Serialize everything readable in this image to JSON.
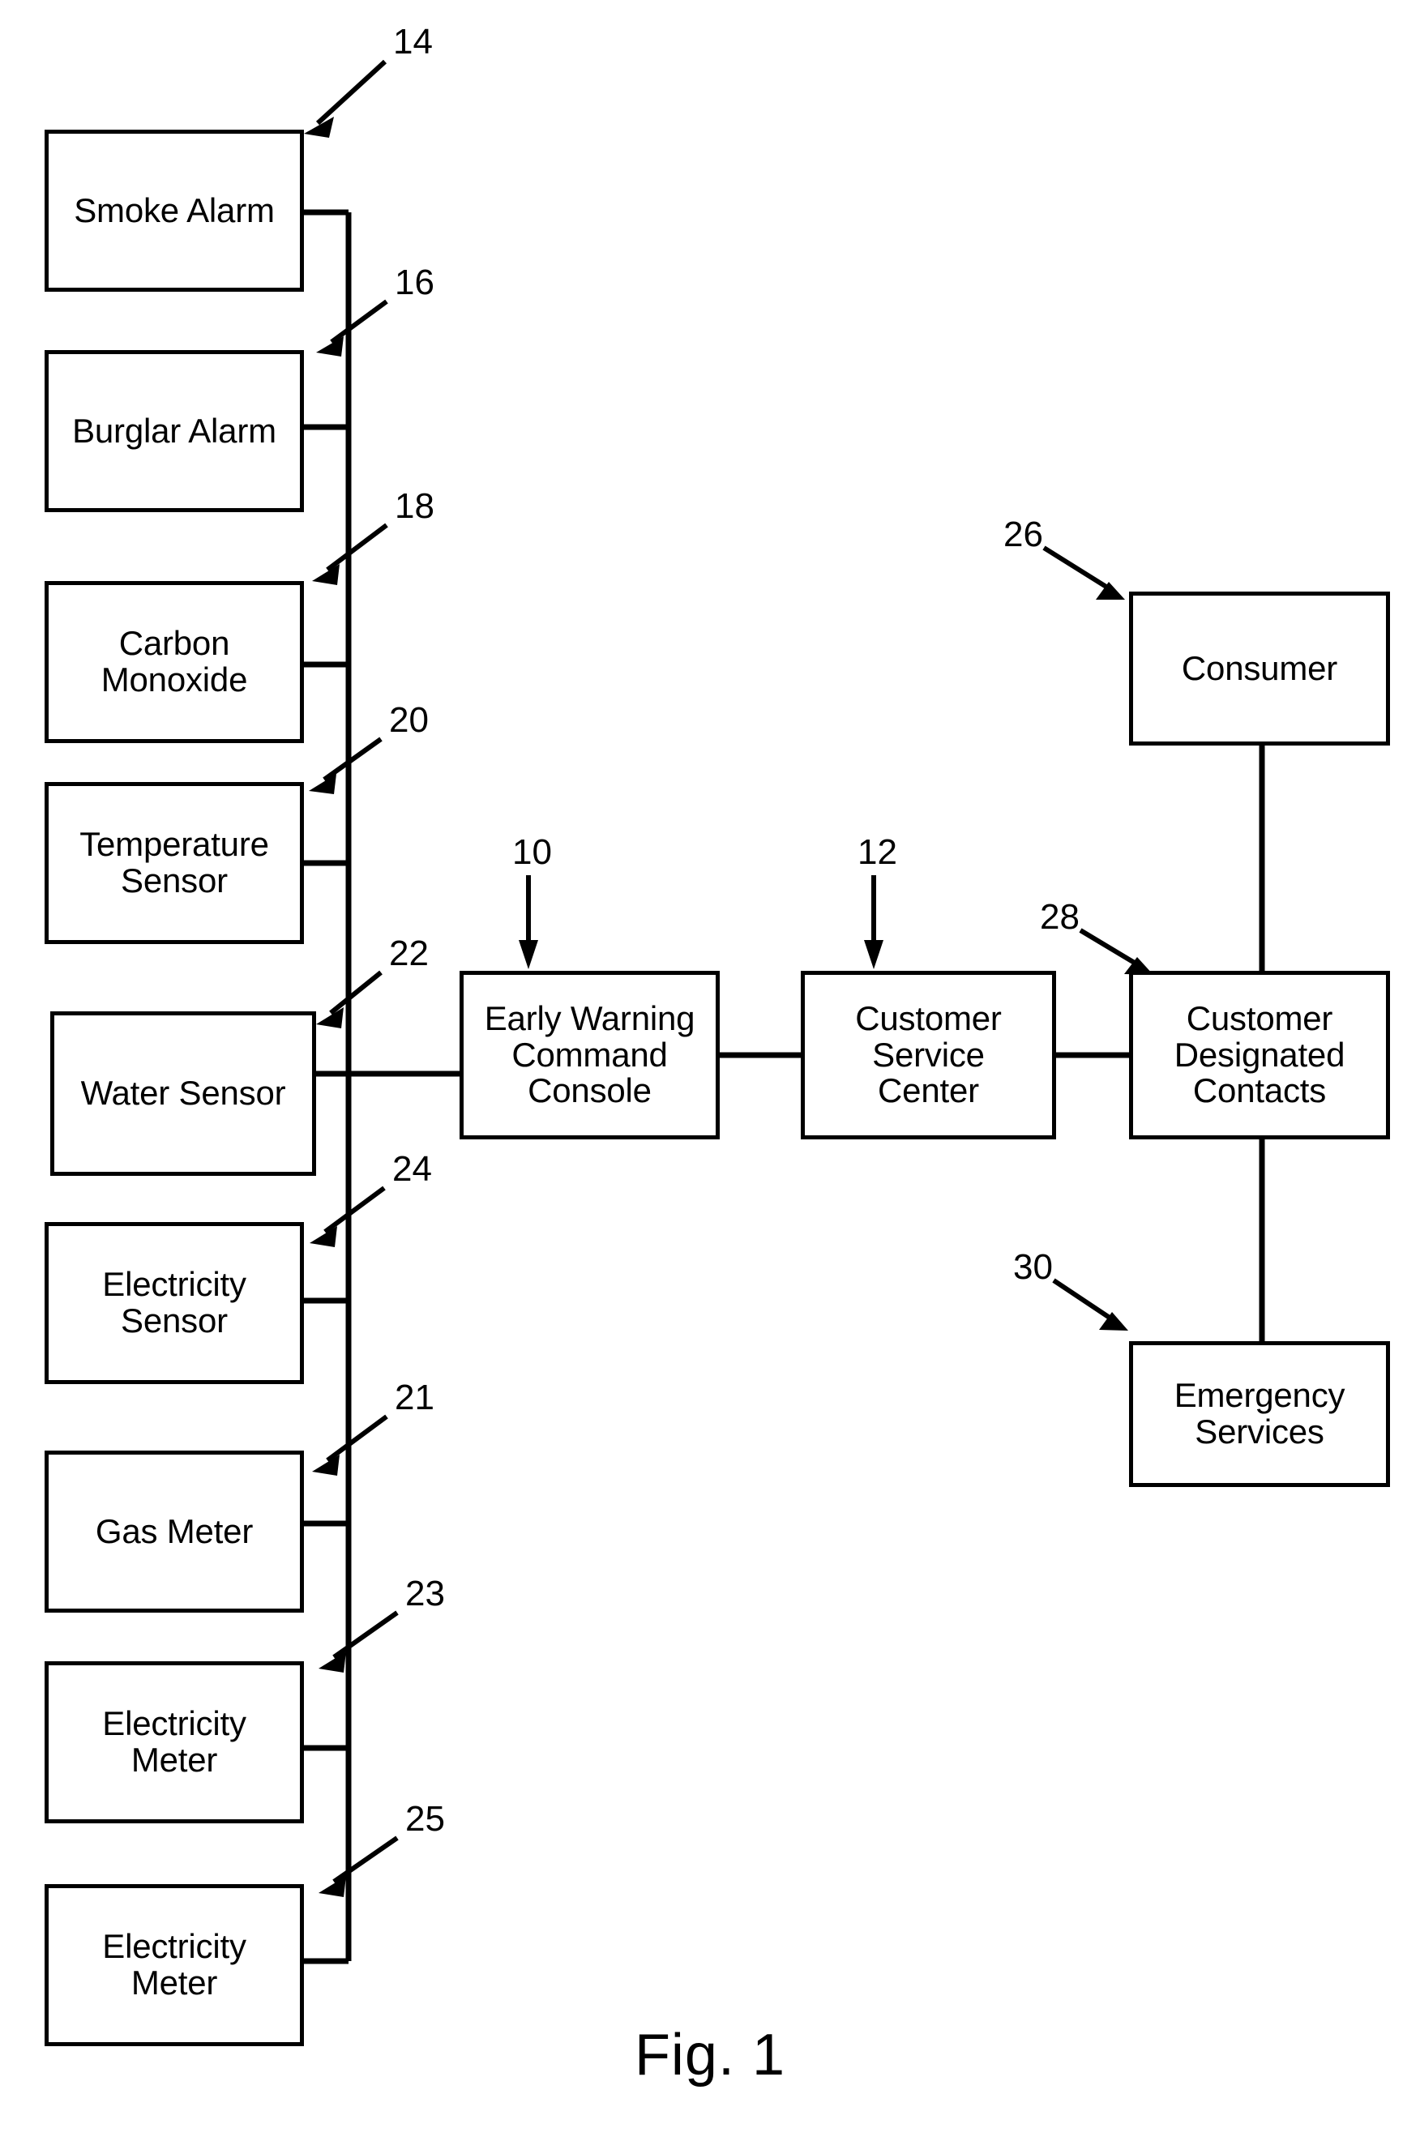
{
  "figure": {
    "caption": "Fig. 1",
    "ink_color": "#000000",
    "background_color": "#ffffff"
  },
  "nodes": {
    "smoke_alarm": {
      "label": "Smoke Alarm",
      "ref": "14"
    },
    "burglar_alarm": {
      "label": "Burglar Alarm",
      "ref": "16"
    },
    "carbon_monoxide": {
      "label": "Carbon\nMonoxide",
      "ref": "18"
    },
    "temperature_sensor": {
      "label": "Temperature\nSensor",
      "ref": "20"
    },
    "water_sensor": {
      "label": "Water Sensor",
      "ref": "22"
    },
    "electricity_sensor": {
      "label": "Electricity\nSensor",
      "ref": "24"
    },
    "gas_meter": {
      "label": "Gas Meter",
      "ref": "21"
    },
    "electricity_meter_1": {
      "label": "Electricity\nMeter",
      "ref": "23"
    },
    "electricity_meter_2": {
      "label": "Electricity\nMeter",
      "ref": "25"
    },
    "early_warning_command_console": {
      "label": "Early Warning\nCommand\nConsole",
      "ref": "10"
    },
    "customer_service_center": {
      "label": "Customer\nService\nCenter",
      "ref": "12"
    },
    "consumer": {
      "label": "Consumer",
      "ref": "26"
    },
    "customer_designated_contacts": {
      "label": "Customer\nDesignated\nContacts",
      "ref": "28"
    },
    "emergency_services": {
      "label": "Emergency\nServices",
      "ref": "30"
    }
  }
}
